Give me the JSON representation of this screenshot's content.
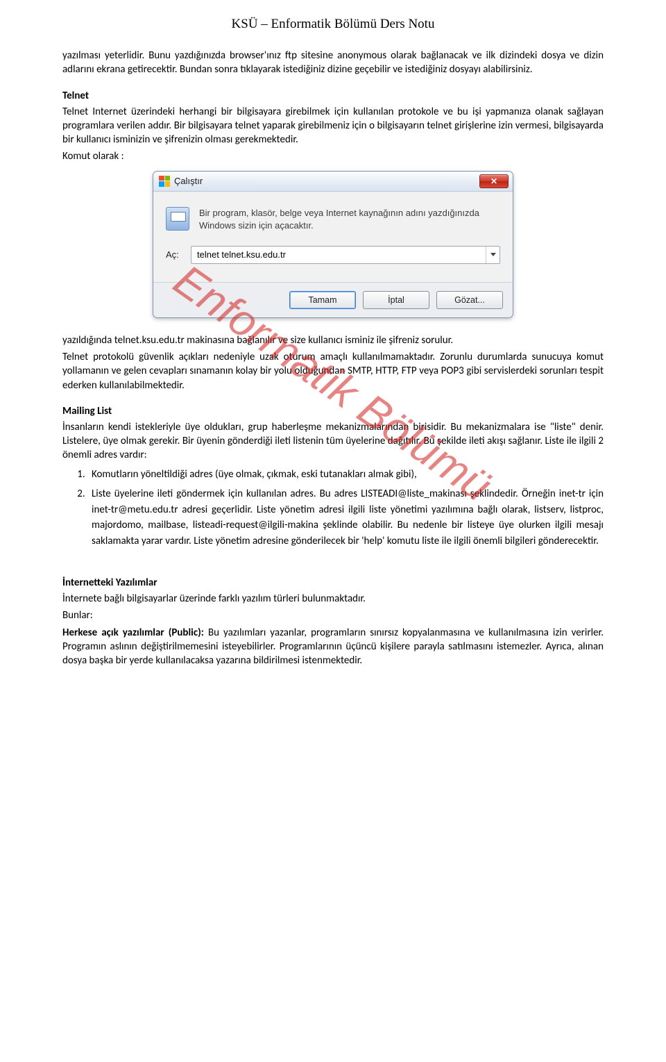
{
  "header": "KSÜ – Enformatik Bölümü Ders Notu",
  "watermark": "Enformatik Bölümü",
  "intro": {
    "p1": "yazılması yeterlidir. Bunu yazdığınızda browser'ınız ftp sitesine anonymous olarak bağlanacak ve ilk dizindeki dosya ve dizin adlarını ekrana getirecektir. Bundan sonra tıklayarak istediğiniz dizine geçebilir ve istediğiniz dosyayı alabilirsiniz."
  },
  "telnet": {
    "heading": "Telnet",
    "p1": "Telnet Internet üzerindeki herhangi bir bilgisayara girebilmek için kullanılan protokole ve bu işi yapmanıza olanak sağlayan programlara verilen addır. Bir bilgisayara telnet yaparak girebilmeniz için o bilgisayarın telnet girişlerine izin vermesi, bilgisayarda bir kullanıcı isminizin ve şifrenizin olması gerekmektedir.",
    "komut": "Komut olarak :"
  },
  "dialog": {
    "title": "Çalıştır",
    "description": "Bir program, klasör, belge veya Internet kaynağının adını yazdığınızda Windows sizin için açacaktır.",
    "label": "Aç:",
    "value": "telnet telnet.ksu.edu.tr",
    "ok": "Tamam",
    "cancel": "İptal",
    "browse": "Gözat..."
  },
  "after_dialog": {
    "p1": "yazıldığında telnet.ksu.edu.tr makinasına bağlanılır ve size kullanıcı isminiz ile şifreniz sorulur.",
    "p2": "Telnet protokolü güvenlik açıkları nedeniyle uzak oturum amaçlı kullanılmamaktadır. Zorunlu durumlarda sunucuya komut yollamanın ve gelen cevapları sınamanın kolay bir yolu olduğundan SMTP, HTTP, FTP veya POP3 gibi servislerdeki sorunları tespit ederken kullanılabilmektedir."
  },
  "mailing": {
    "heading": "Mailing List",
    "p1": "İnsanların kendi istekleriyle üye oldukları, grup haberleşme mekanizmalarından birisidir. Bu mekanizmalara ise \"liste\" denir. Listelere, üye olmak gerekir. Bir üyenin gönderdiği ileti listenin tüm üyelerine dağıtılır. Bu şekilde ileti akışı sağlanır. Liste ile ilgili 2 önemli adres vardır:",
    "li1": "Komutların yöneltildiği adres (üye olmak, çıkmak, eski tutanakları almak gibi),",
    "li2": "Liste üyelerine ileti göndermek için kullanılan adres. Bu adres LISTEADI@liste_makinası şeklindedir. Örneğin inet-tr için inet-tr@metu.edu.tr adresi geçerlidir. Liste yönetim adresi ilgili liste yönetimi yazılımına bağlı olarak, listserv, listproc, majordomo, mailbase, listeadi-request@ilgili-makina şeklinde olabilir. Bu nedenle bir listeye üye olurken ilgili mesajı saklamakta yarar vardır. Liste yönetim adresine gönderilecek bir 'help' komutu liste ile ilgili önemli bilgileri gönderecektir."
  },
  "software": {
    "heading": "İnternetteki Yazılımlar",
    "p1": "İnternete bağlı bilgisayarlar üzerinde farklı yazılım türleri bulunmaktadır.",
    "bunlar": "Bunlar:",
    "public_label": "Herkese açık yazılımlar (Public): ",
    "public_text": "Bu yazılımları yazanlar, programların sınırsız kopyalanmasına ve kullanılmasına izin verirler. Programın aslının değiştirilmemesini isteyebilirler. Programlarının üçüncü kişilere parayla satılmasını istemezler. Ayrıca, alınan dosya başka bir yerde kullanılacaksa yazarına bildirilmesi istenmektedir."
  }
}
